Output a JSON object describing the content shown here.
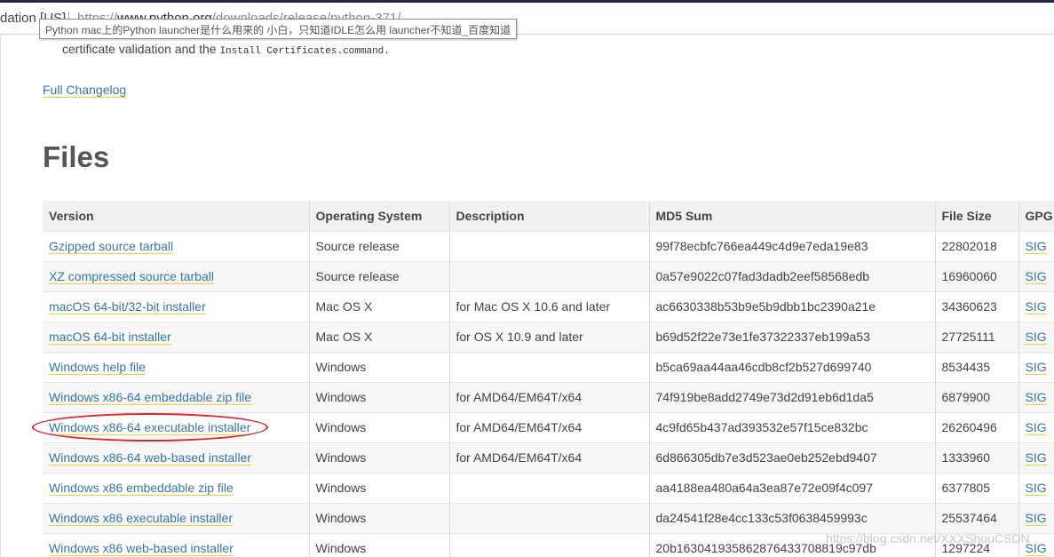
{
  "browser": {
    "security_label": "dation [US]",
    "url_prefix": "https://",
    "url_host": "www.python.org",
    "url_path": "/downloads/release/python-371/",
    "tooltip": "Python mac上的Python launcher是什么用来的 小白，只知道IDLE怎么用 launcher不知道_百度知道"
  },
  "page": {
    "cert_text": "certificate validation and the",
    "cert_code": "Install Certificates.command.",
    "changelog_link": "Full Changelog",
    "files_heading": "Files",
    "watermark": "https://blog.csdn.net/XXXShouCSDN"
  },
  "table": {
    "headers": [
      "Version",
      "Operating System",
      "Description",
      "MD5 Sum",
      "File Size",
      "GPG"
    ],
    "rows": [
      {
        "version": "Gzipped source tarball",
        "os": "Source release",
        "desc": "",
        "md5": "99f78ecbfc766ea449c4d9e7eda19e83",
        "size": "22802018",
        "gpg": "SIG"
      },
      {
        "version": "XZ compressed source tarball",
        "os": "Source release",
        "desc": "",
        "md5": "0a57e9022c07fad3dadb2eef58568edb",
        "size": "16960060",
        "gpg": "SIG"
      },
      {
        "version": "macOS 64-bit/32-bit installer",
        "os": "Mac OS X",
        "desc": "for Mac OS X 10.6 and later",
        "md5": "ac6630338b53b9e5b9dbb1bc2390a21e",
        "size": "34360623",
        "gpg": "SIG"
      },
      {
        "version": "macOS 64-bit installer",
        "os": "Mac OS X",
        "desc": "for OS X 10.9 and later",
        "md5": "b69d52f22e73e1fe37322337eb199a53",
        "size": "27725111",
        "gpg": "SIG"
      },
      {
        "version": "Windows help file",
        "os": "Windows",
        "desc": "",
        "md5": "b5ca69aa44aa46cdb8cf2b527d699740",
        "size": "8534435",
        "gpg": "SIG"
      },
      {
        "version": "Windows x86-64 embeddable zip file",
        "os": "Windows",
        "desc": "for AMD64/EM64T/x64",
        "md5": "74f919be8add2749e73d2d91eb6d1da5",
        "size": "6879900",
        "gpg": "SIG"
      },
      {
        "version": "Windows x86-64 executable installer",
        "os": "Windows",
        "desc": "for AMD64/EM64T/x64",
        "md5": "4c9fd65b437ad393532e57f15ce832bc",
        "size": "26260496",
        "gpg": "SIG"
      },
      {
        "version": "Windows x86-64 web-based installer",
        "os": "Windows",
        "desc": "for AMD64/EM64T/x64",
        "md5": "6d866305db7e3d523ae0eb252ebd9407",
        "size": "1333960",
        "gpg": "SIG"
      },
      {
        "version": "Windows x86 embeddable zip file",
        "os": "Windows",
        "desc": "",
        "md5": "aa4188ea480a64a3ea87e72e09f4c097",
        "size": "6377805",
        "gpg": "SIG"
      },
      {
        "version": "Windows x86 executable installer",
        "os": "Windows",
        "desc": "",
        "md5": "da24541f28e4cc133c53f0638459993c",
        "size": "25537464",
        "gpg": "SIG"
      },
      {
        "version": "Windows x86 web-based installer",
        "os": "Windows",
        "desc": "",
        "md5": "20b163041935862876433708819c97db",
        "size": "1297224",
        "gpg": "SIG"
      }
    ]
  },
  "annotation": {
    "highlight_color": "#d9252a"
  }
}
